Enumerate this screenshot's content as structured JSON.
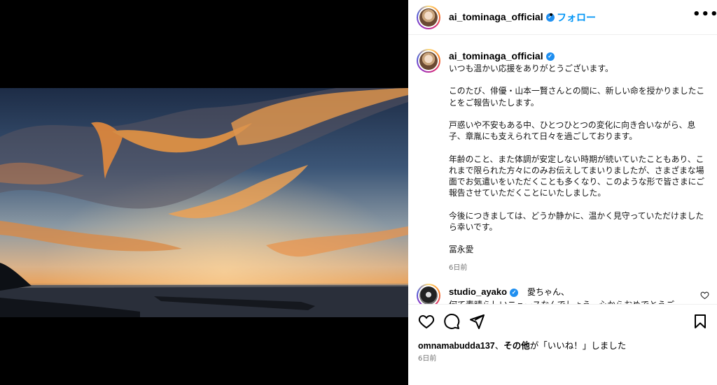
{
  "header": {
    "username": "ai_tominaga_official",
    "separator": "•",
    "follow_label": "フォロー",
    "more_label": "•••"
  },
  "caption": {
    "username": "ai_tominaga_official",
    "text": "いつも温かい応援をありがとうございます。\n\nこのたび、俳優・山本一賢さんとの間に、新しい命を授かりましたことをご報告いたします。\n\n戸惑いや不安もある中、ひとつひとつの変化に向き合いながら、息子、章胤にも支えられて日々を過ごしております。\n\n年齢のこと、また体調が安定しない時期が続いていたこともあり、これまで限られた方々にのみお伝えしてまいりましたが、さまざまな場面でお気遣いをいただくことも多くなり、このような形で皆さまにご報告させていただくことにいたしました。\n\n今後につきましては、どうか静かに、温かく見守っていただけましたら幸いです。\n\n冨永愛",
    "time": "6日前"
  },
  "comment": {
    "username": "studio_ayako",
    "text_line1": "愛ちゃん、",
    "text_line2": "何て素晴らしいニュースなんでしょう。心からおめでとうご"
  },
  "actions": {
    "likes_user": "omnamabudda137",
    "likes_connector": "、",
    "likes_others": "その他",
    "likes_suffix": "が「いいね！」しました",
    "time": "6日前"
  },
  "icons": {
    "verified": "verified-badge-icon",
    "heart": "heart-icon",
    "comment": "comment-icon",
    "share": "share-icon",
    "save": "bookmark-icon"
  },
  "colors": {
    "accent": "#0095f6",
    "verified": "#1f8ff0",
    "muted": "#737373"
  }
}
